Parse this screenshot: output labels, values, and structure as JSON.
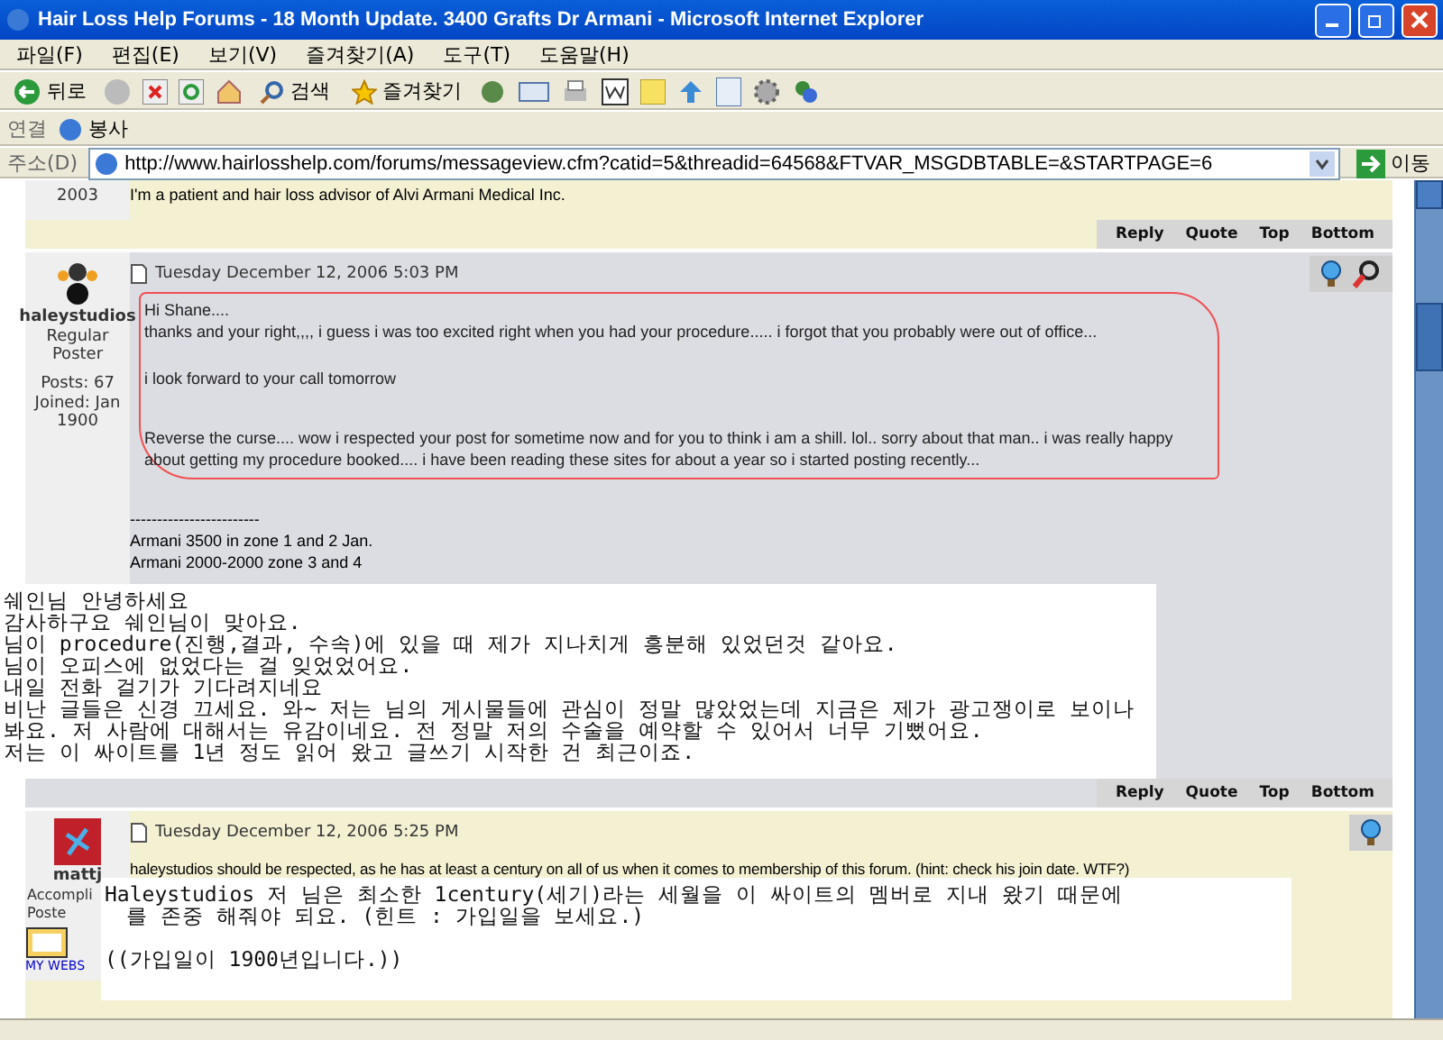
{
  "window": {
    "title": "Hair Loss Help Forums - 18 Month Update. 3400 Grafts Dr Armani - Microsoft Internet Explorer"
  },
  "menu": [
    "파일(F)",
    "편집(E)",
    "보기(V)",
    "즐겨찾기(A)",
    "도구(T)",
    "도움말(H)"
  ],
  "toolbar": {
    "back": "뒤로",
    "search": "검색",
    "favorites": "즐겨찾기"
  },
  "links_bar": {
    "label": "연결",
    "link": "봉사"
  },
  "address_bar": {
    "label": "주소(D)",
    "url": "http://www.hairlosshelp.com/forums/messageview.cfm?catid=5&threadid=64568&FTVAR_MSGDBTABLE=&STARTPAGE=6",
    "go": "이동"
  },
  "posts": [
    {
      "color": "#f4f0d2",
      "sidebar_lines": [
        "2003"
      ],
      "body": [
        "I'm a patient and hair loss advisor of Alvi Armani Medical Inc."
      ],
      "actions": [
        "Reply",
        "Quote",
        "Top",
        "Bottom"
      ]
    },
    {
      "color": "#dcdde3",
      "author": "haleystudios",
      "rank": "Regular Poster",
      "stats": [
        "Posts: 67",
        "Joined: Jan 1900"
      ],
      "date": "Tuesday December 12, 2006 5:03 PM",
      "tool_icons": [
        {
          "kind": "bulb"
        },
        {
          "kind": "search"
        }
      ],
      "circled": true,
      "body": [
        "Hi Shane....",
        "thanks and your right,,,, i guess i was too excited right when you had your procedure..... i forgot that you probably were out of office...",
        "i look forward to your call tomorrow",
        "Reverse the curse.... wow i respected your post for sometime now and for you to think i am a shill. lol.. sorry about that man.. i was really happy about getting my procedure booked.... i have been reading these sites for about a year so i started posting recently..."
      ],
      "signature": [
        "------------------------",
        "Armani 3500 in zone 1 and 2 Jan.",
        "Armani 2000-2000 zone 3 and 4"
      ],
      "annotation": [
        "쉐인님 안녕하세요",
        "감사하구요 쉐인님이 맞아요.",
        "님이 procedure(진행,결과, 수속)에 있을 때 제가 지나치게 흥분해 있었던것 같아요.",
        "님이 오피스에 없었다는 걸 잊었었어요.",
        "내일 전화 걸기가 기다려지네요",
        "비난 글들은 신경 끄세요. 와~ 저는 님의 게시물들에 관심이 정말 많았었는데 지금은 제가 광고쟁이로 보이나봐요. 저 사람에 대해서는 유감이네요. 전 정말 저의 수술을 예약할 수 있어서 너무 기뻤어요.",
        "저는 이 싸이트를 1년 정도 읽어 왔고 글쓰기 시작한 건 최근이죠."
      ],
      "actions": [
        "Reply",
        "Quote",
        "Top",
        "Bottom"
      ]
    },
    {
      "color": "#f4f0d2",
      "author": "mattj",
      "rank_lines": [
        "Accompli",
        "Poste"
      ],
      "website": "MY WEBS",
      "date": "Tuesday December 12, 2006 5:25 PM",
      "tool_icons": [
        {
          "kind": "bulb"
        }
      ],
      "body": [
        "haleystudios should be respected, as he has at least a century on all of us when it comes to membership of this forum. (hint: check his join date. WTF?)"
      ],
      "annotation": [
        "Haleystudios 저 님은 최소한 1century(세기)라는 세월을 이 싸이트의 멤버로 지내 왔기 때문에",
        "를 존중 해줘야 되요. (힌트 : 가입일을 보세요.)",
        "((가입일이 1900년입니다.))"
      ]
    }
  ]
}
